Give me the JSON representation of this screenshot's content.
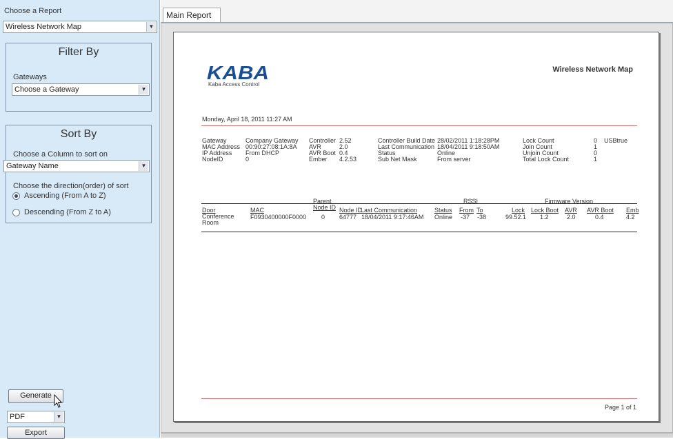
{
  "sidebar": {
    "choose_report_label": "Choose a Report",
    "report_value": "Wireless Network Map",
    "filter": {
      "title": "Filter By",
      "gateways_label": "Gateways",
      "gateway_value": "Choose a Gateway"
    },
    "sort": {
      "title": "Sort By",
      "column_label": "Choose a Column to sort on",
      "column_value": "Gateway Name",
      "direction_label": "Choose the direction(order) of sort",
      "ascending_label": "Ascending (From A to Z)",
      "descending_label": "Descending (From Z to A)",
      "selected": "ascending"
    },
    "generate_label": "Generate",
    "format_value": "PDF",
    "export_label": "Export"
  },
  "main": {
    "tab_label": "Main Report"
  },
  "report": {
    "logo_text": "KABA",
    "logo_sub": "Kaba Access Control",
    "title": "Wireless Network Map",
    "date": "Monday, April 18, 2011 11:27 AM",
    "info_col1_labels": [
      "Gateway",
      "MAC Address",
      "IP Address",
      "NodeID"
    ],
    "info_col1_values": [
      "Company Gateway",
      "00:90:27:08:1A:8A",
      "From DHCP",
      "0"
    ],
    "info_col2_labels": [
      "Controller",
      "AVR",
      "AVR Boot",
      "Ember"
    ],
    "info_col2_values": [
      "2.52",
      "2.0",
      "0.4",
      "4.2.53"
    ],
    "info_col3_labels": [
      "Controller Build Date",
      "Last Communication",
      "Status",
      "Sub Net Mask"
    ],
    "info_col3_values": [
      "28/02/2011 1:18:28PM",
      "18/04/2011 9:18:50AM",
      "Online",
      "From server"
    ],
    "info_col4_labels": [
      "Lock Count",
      "Join Count",
      "Unjoin Count",
      "Total Lock Count"
    ],
    "info_col4_values": [
      "0",
      "1",
      "0",
      "1"
    ],
    "info_extra": "USBtrue",
    "table": {
      "group_parent": "Parent",
      "group_rssi": "RSSI",
      "group_firmware": "Firmware Version",
      "headers": {
        "door": "Door",
        "mac": "MAC",
        "parent_node_id": "Node ID",
        "node_id": "Node ID",
        "last_comm": "Last Communication",
        "status": "Status",
        "from": "From",
        "to": "To",
        "lock": "Lock",
        "lock_boot": "Lock Boot",
        "avr": "AVR",
        "avr_boot": "AVR Boot",
        "emb": "Emb"
      },
      "row": {
        "door": "Conference Room",
        "mac": "F0930400000F0000",
        "parent_node_id": "0",
        "node_id": "64777",
        "last_comm": "18/04/2011 9:17:46AM",
        "status": "Online",
        "from": "-37",
        "to": "-38",
        "lock": "99.52.1",
        "lock_boot": "1.2",
        "avr": "2.0",
        "avr_boot": "0.4",
        "emb": "4.2"
      }
    },
    "page_label": "Page 1 of 1"
  },
  "colors": {
    "panel_bg": "#d8e9f7",
    "panel_border": "#7d91a6",
    "logo_blue": "#1a4f96",
    "rule_red": "#cc6b6b"
  }
}
